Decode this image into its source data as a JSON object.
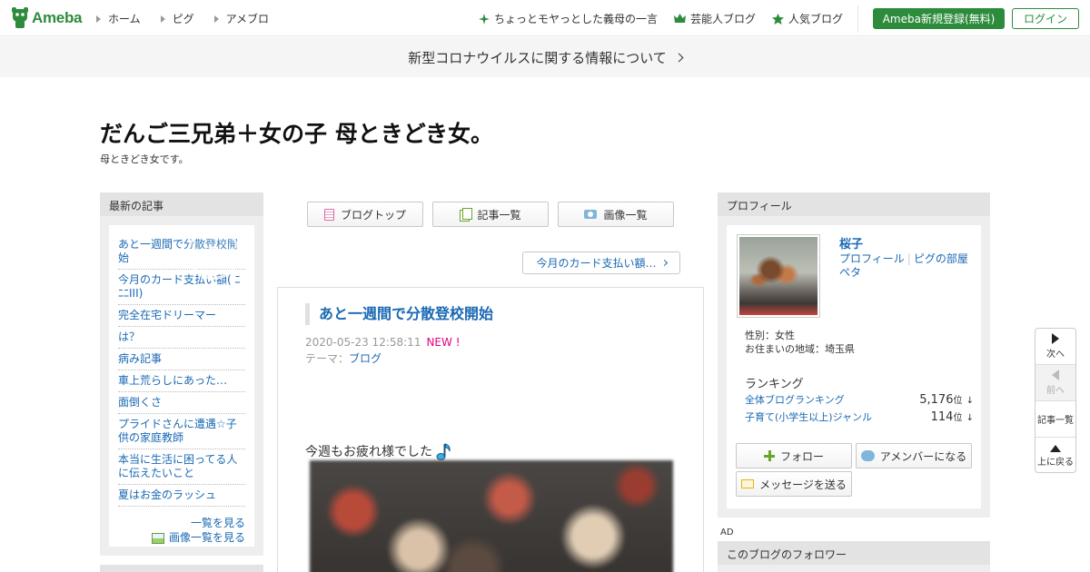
{
  "header": {
    "logo_text": "Ameba",
    "nav": [
      "ホーム",
      "ピグ",
      "アメブロ"
    ],
    "right_links": [
      {
        "label": "ちょっとモヤっとした義母の一言",
        "icon": "sparkle-icon"
      },
      {
        "label": "芸能人ブログ",
        "icon": "crown-icon"
      },
      {
        "label": "人気ブログ",
        "icon": "star-icon"
      }
    ],
    "register_label": "Ameba新規登録(無料)",
    "login_label": "ログイン"
  },
  "banner": {
    "text": "新型コロナウイルスに関する情報について"
  },
  "blog": {
    "title": "だんご三兄弟＋女の子 母ときどき女。",
    "description": "母ときどき女です。"
  },
  "left_sidebar": {
    "heading": "最新の記事",
    "articles": [
      "あと一週間で分散登校開始",
      "今月のカード支払い額( ﾆﾆﾆIII)",
      "完全在宅ドリーマー",
      "は？",
      "病み記事",
      "車上荒らしにあった…",
      "面倒くさ",
      "プライドさんに遭遇☆子供の家庭教師",
      "本当に生活に困ってる人に伝えたいこと",
      "夏はお金のラッシュ"
    ],
    "list_all": "一覧を見る",
    "image_list": "画像一覧を見る"
  },
  "center": {
    "nav_buttons": [
      "ブログトップ",
      "記事一覧",
      "画像一覧"
    ],
    "next_article": "今月のカード支払い額…",
    "article": {
      "title": "あと一週間で分散登校開始",
      "date": "2020-05-23 12:58:11",
      "new_badge": "NEW !",
      "theme_label": "テーマ：",
      "theme": "ブログ",
      "body_text": "今週もお疲れ様でした"
    }
  },
  "profile": {
    "heading": "プロフィール",
    "name": "桜子",
    "links": [
      "プロフィール",
      "ピグの部屋",
      "ペタ"
    ],
    "gender": "性別：女性",
    "location": "お住まいの地域：埼玉県",
    "ranking_heading": "ランキング",
    "rankings": [
      {
        "label": "全体ブログランキング",
        "value": "5,176",
        "unit": "位",
        "arrow": "↓"
      },
      {
        "label": "子育て(小学生以上)ジャンル",
        "value": "114",
        "unit": "位",
        "arrow": "↓"
      }
    ],
    "follow_label": "フォロー",
    "amember_label": "アメンバーになる",
    "message_label": "メッセージを送る"
  },
  "ad_label": "AD",
  "follower_heading": "このブログのフォロワー",
  "side_nav": {
    "next": "次へ",
    "prev": "前へ",
    "articles": "記事一覧",
    "top": "上に戻る"
  },
  "colors": {
    "brand_green": "#2d8c3c",
    "link_blue": "#1a69b4",
    "new_pink": "#e4007f"
  }
}
